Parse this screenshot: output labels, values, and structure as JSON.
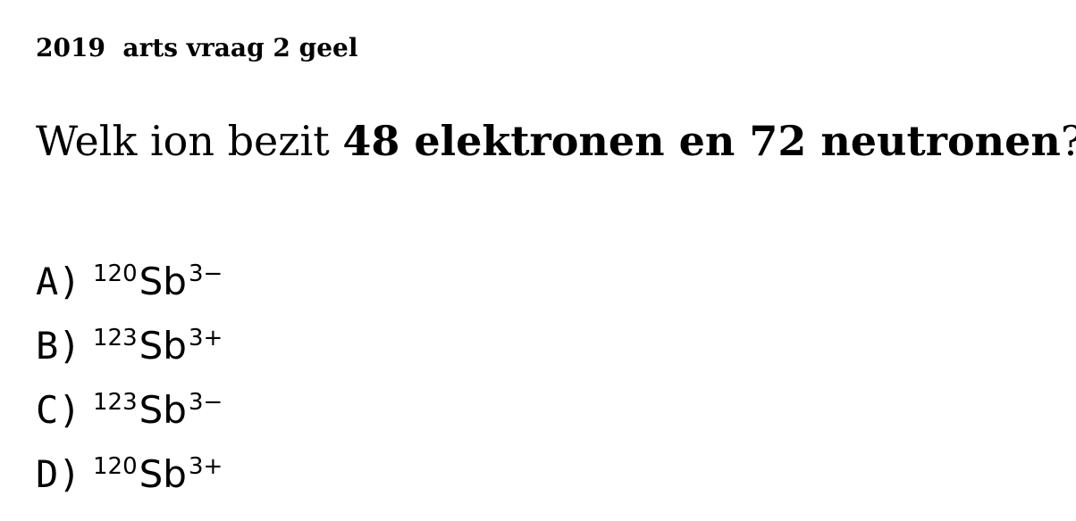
{
  "header": {
    "text": "2019  arts vraag 2 geel"
  },
  "question": {
    "prefix": "Welk ion bezit ",
    "bold": "48 elektronen en 72 neutronen",
    "suffix": "?"
  },
  "options": [
    {
      "letter": "A)",
      "mass": "120",
      "element": "Sb",
      "charge": "3−"
    },
    {
      "letter": "B)",
      "mass": "123",
      "element": "Sb",
      "charge": "3+"
    },
    {
      "letter": "C)",
      "mass": "123",
      "element": "Sb",
      "charge": "3−"
    },
    {
      "letter": "D)",
      "mass": "120",
      "element": "Sb",
      "charge": "3+"
    }
  ]
}
